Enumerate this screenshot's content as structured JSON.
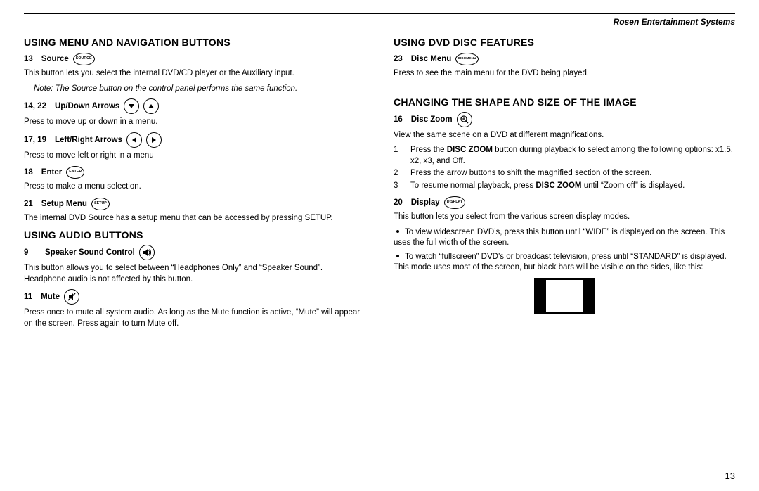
{
  "header": {
    "brand": "Rosen Entertainment Systems"
  },
  "page_number": "13",
  "left": {
    "h_menu": "USING MENU AND NAVIGATION BUTTONS",
    "source": {
      "num": "13",
      "label": "Source",
      "icon": "SOURCE",
      "desc": "This button lets you select the internal DVD/CD player or the Auxiliary input.",
      "note": "Note: The Source button on the control panel performs the same function."
    },
    "updown": {
      "num": "14, 22",
      "label": "Up/Down Arrows",
      "desc": "Press to move up or down in a menu."
    },
    "leftright": {
      "num": "17, 19",
      "label": "Left/Right Arrows",
      "desc": "Press to move left or right in a menu"
    },
    "enter": {
      "num": "18",
      "label": "Enter",
      "icon": "ENTER",
      "desc": "Press to make a menu selection."
    },
    "setup": {
      "num": "21",
      "label": "Setup Menu",
      "icon": "SETUP",
      "desc": "The internal DVD Source has a setup menu that can be accessed by pressing SETUP."
    },
    "h_audio": "USING AUDIO BUTTONS",
    "speaker": {
      "num": "9",
      "label": "Speaker Sound Control",
      "desc": "This button allows you to select between “Headphones Only” and “Speaker Sound”. Headphone audio is not affected by this button."
    },
    "mute": {
      "num": "11",
      "label": "Mute",
      "desc": "Press once to mute all system audio. As long as the Mute function is active, “Mute” will appear on the screen. Press again to turn Mute off."
    }
  },
  "right": {
    "h_dvd": "USING DVD DISC FEATURES",
    "discmenu": {
      "num": "23",
      "label": "Disc Menu",
      "icon_top": "DISC",
      "icon_bot": "MENU",
      "desc": "Press to see the main menu for the DVD being played."
    },
    "h_shape": "CHANGING THE SHAPE AND SIZE OF THE IMAGE",
    "zoom": {
      "num": "16",
      "label": "Disc Zoom",
      "desc": "View the same scene on a DVD at different magnifications.",
      "s1a": "Press the ",
      "s1b": "DISC ZOOM",
      "s1c": " button during playback to select among the following options: x1.5, x2, x3, and Off.",
      "s2": "Press the arrow buttons to shift the magnified section of the screen.",
      "s3a": "To resume normal playback, press ",
      "s3b": "DISC ZOOM",
      "s3c": " until “Zoom off” is displayed."
    },
    "display": {
      "num": "20",
      "label": "Display",
      "icon": "DISPLAY",
      "desc": "This button lets you select from the various screen display modes.",
      "b1": "To view widescreen DVD’s, press this button until “WIDE” is displayed on the screen. This uses the full width of the screen.",
      "b2": "To watch “fullscreen” DVD’s or broadcast television, press until “STANDARD” is displayed. This mode uses most of the screen, but black bars will be visible on the sides, like this:"
    }
  }
}
